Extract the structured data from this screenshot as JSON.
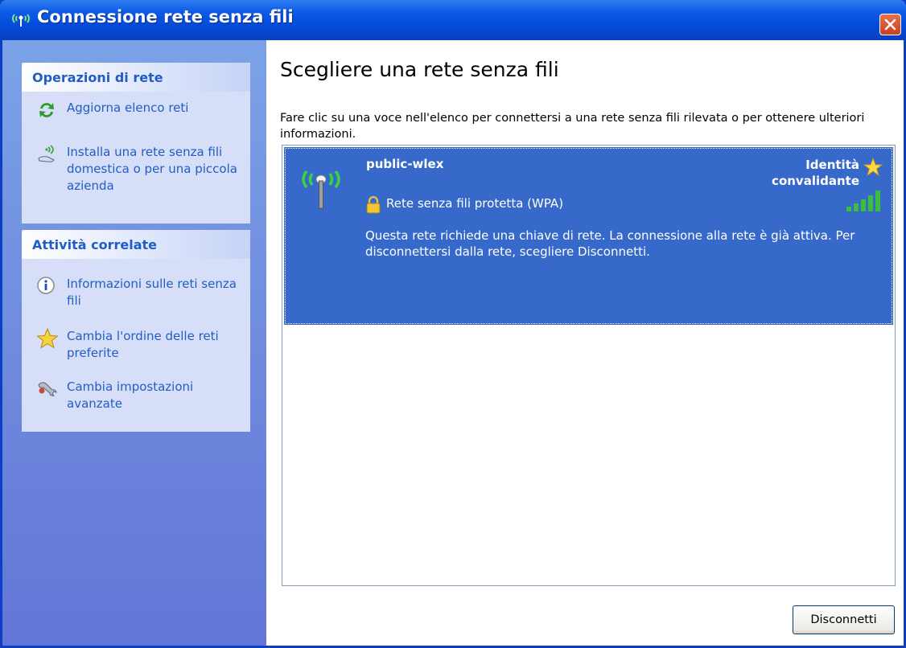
{
  "window": {
    "title": "Connessione rete senza fili",
    "title_icon": "wireless-network-icon",
    "close_icon": "close-icon"
  },
  "sidebar": {
    "sections": [
      {
        "title": "Operazioni di rete",
        "items": [
          {
            "label": "Aggiorna elenco reti",
            "icon": "refresh-icon"
          },
          {
            "label": "Installa una rete senza fili domestica o per una piccola azienda",
            "icon": "wireless-setup-icon"
          }
        ]
      },
      {
        "title": "Attività correlate",
        "items": [
          {
            "label": "Informazioni sulle reti senza fili",
            "icon": "info-icon"
          },
          {
            "label": "Cambia l'ordine delle reti preferite",
            "icon": "star-icon"
          },
          {
            "label": "Cambia impostazioni avanzate",
            "icon": "settings-icon"
          }
        ]
      }
    ]
  },
  "main": {
    "title": "Scegliere una rete senza fili",
    "description": "Fare clic su una voce nell'elenco per connettersi a una rete senza fili rilevata o per ottenere ulteriori informazioni.",
    "networks": [
      {
        "name": "public-wlex",
        "status": "Identità convalidante",
        "security": "Rete senza fili protetta (WPA)",
        "description": "Questa rete richiede una chiave di rete. La connessione alla rete è già attiva. Per disconnettersi dalla rete, scegliere Disconnetti.",
        "signal_bars": 5,
        "signal_max": 5,
        "selected": true
      }
    ],
    "disconnect_button": "Disconnetti"
  },
  "colors": {
    "title_bar": "#0b5ae6",
    "sidebar_bg": "#6f8fe0",
    "task_text": "#215dc6",
    "selected_item": "#3669c9",
    "close_button": "#d4502e"
  }
}
